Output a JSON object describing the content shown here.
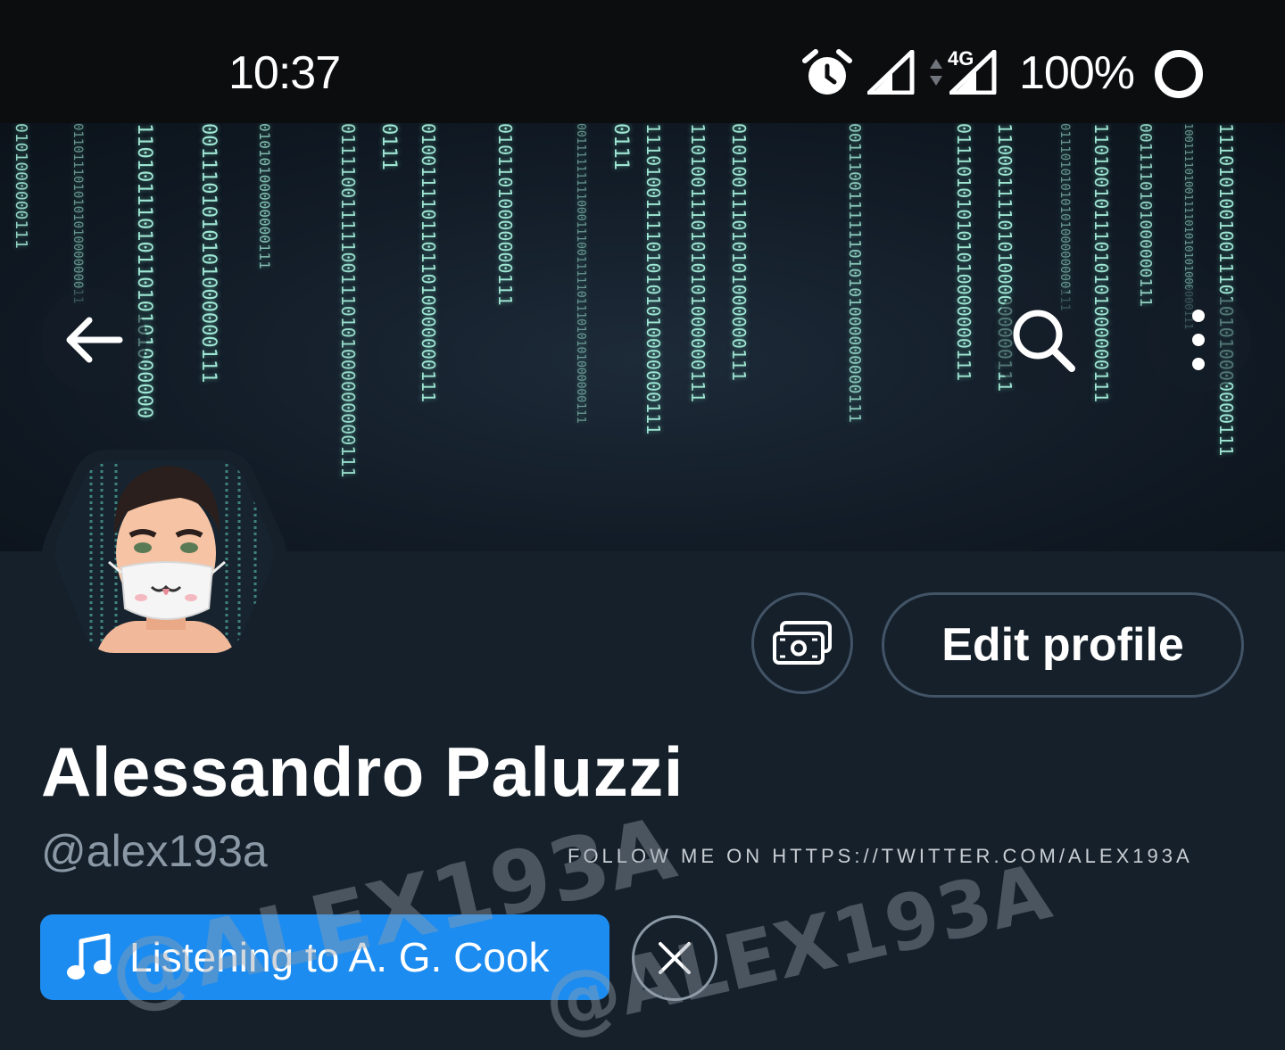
{
  "status_bar": {
    "time": "10:37",
    "network_label": "4G",
    "battery_percent": "100%",
    "icons": [
      "alarm-icon",
      "signal-icon",
      "data-arrows-icon",
      "signal-4g-icon",
      "battery-ring-icon"
    ]
  },
  "banner": {
    "code_strings": [
      "0101000000111",
      "011011101010101000000011",
      "1101011101011010101000000",
      "0011101010101000000111",
      "01010100000000111",
      "011110011111001110101000000000111",
      "0111",
      "01001111011011010000000111",
      "01011010000000111",
      "0011111111100011100111110111010101000000111",
      "0111",
      "11101001111010101010000000111",
      "11010011101010101000000111",
      "010100111010101000000111",
      "0011100111111010101000000000111",
      "011101010101010000000111",
      "1100011110101000000000111",
      "0111010101010100000000111",
      "11010010111010101000000111",
      "0011110101000000111",
      "10011110100111101010101000000111",
      "1110101001001110101010000000111"
    ],
    "back_icon": "arrow-left-icon",
    "search_icon": "search-icon",
    "more_icon": "more-vertical-icon"
  },
  "profile": {
    "display_name": "Alessandro Paluzzi",
    "handle": "@alex193a",
    "edit_profile_label": "Edit profile",
    "tip_icon": "money-icon",
    "follow_note": "FOLLOW ME ON HTTPS://TWITTER.COM/ALEX193A",
    "listening_label": "Listening to A. G. Cook",
    "music_icon": "music-note-icon",
    "dismiss_icon": "close-icon"
  },
  "watermark": {
    "text": "@ALEX193A"
  },
  "colors": {
    "background": "#15202b",
    "status_bar": "#0c0d0f",
    "accent_blue": "#1d8cf0",
    "muted_text": "#8b98a5",
    "button_border": "#425466",
    "banner_code": "#9fe6d3"
  }
}
